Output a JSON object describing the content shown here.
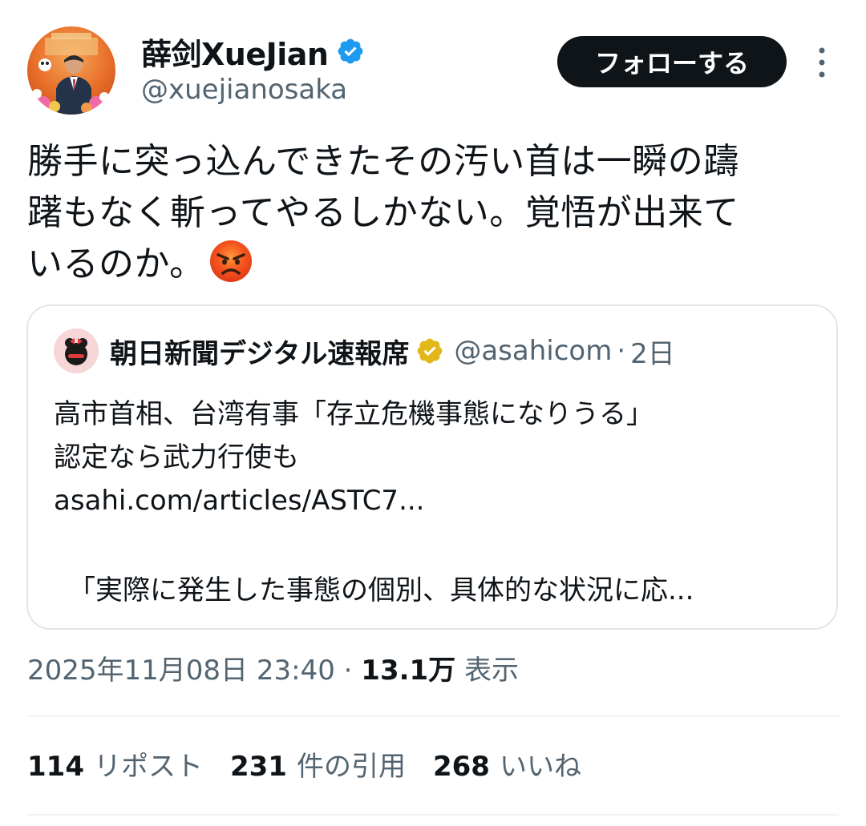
{
  "author": {
    "display_name": "薛剑XueJian",
    "handle": "@xuejianosaka",
    "verified_color": "#1d9bf0",
    "avatar_icon": "profile-photo"
  },
  "actions": {
    "follow_label": "フォローする",
    "more_icon": "vertical-ellipsis-icon"
  },
  "tweet": {
    "lines": [
      "勝手に突っ込んできたその汚い首は一瞬の躊",
      "躇もなく斬ってやるしかない。覚悟が出来て",
      "いるのか。"
    ],
    "emoji": "angry-face-emoji"
  },
  "quote": {
    "display_name": "朝日新聞デジタル速報席",
    "handle": "@asahicom",
    "separator": "·",
    "time": "2日",
    "verified_color": "#e2b719",
    "lines": [
      "高市首相、台湾有事「存立危機事態になりうる」",
      "認定なら武力行使も"
    ],
    "link_text": "asahi.com/articles/ASTC7...",
    "excerpt": "「実際に発生した事態の個別、具体的な状況に応..."
  },
  "meta": {
    "timestamp": "2025年11月08日 23:40",
    "separator": "·",
    "views_count": "13.1万",
    "views_label": "表示"
  },
  "stats": {
    "reposts_count": "114",
    "reposts_label": "リポスト",
    "quotes_count": "231",
    "quotes_label": "件の引用",
    "likes_count": "268",
    "likes_label": "いいね"
  },
  "colors": {
    "text_primary": "#0f1419",
    "text_secondary": "#536471",
    "border": "#e3e6e9"
  }
}
